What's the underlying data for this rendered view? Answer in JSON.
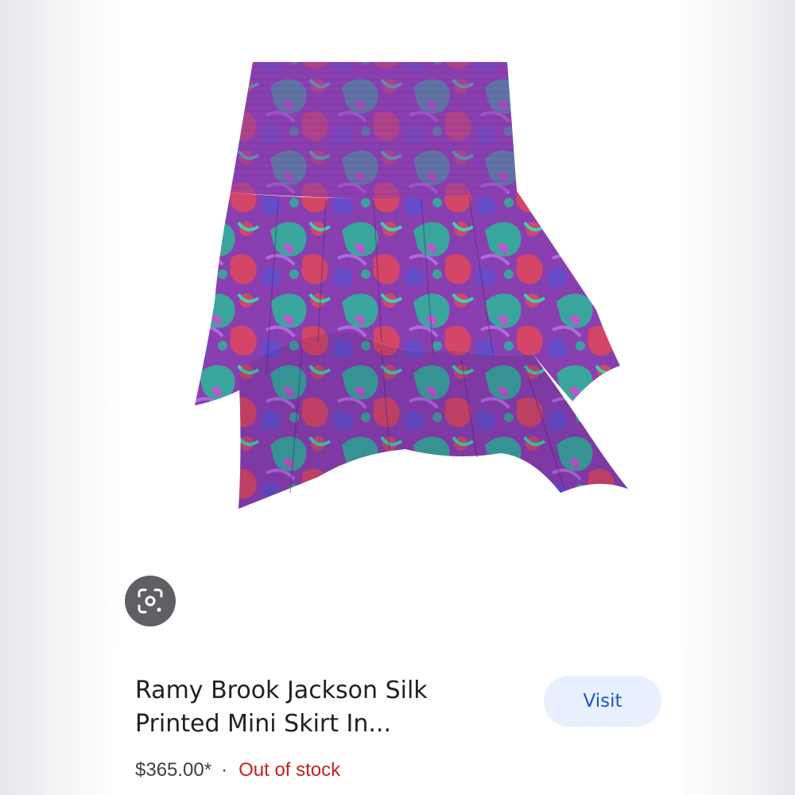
{
  "product": {
    "title": "Ramy Brook Jackson Silk Printed Mini Skirt In...",
    "price": "$365.00*",
    "separator": "·",
    "availability": "Out of stock",
    "availability_color": "#c5221f"
  },
  "actions": {
    "visit_label": "Visit",
    "lens_icon": "google-lens-icon"
  },
  "colors": {
    "visit_bg": "#e8f0fe",
    "visit_text": "#1a56c4",
    "lens_bg": "#5f6064"
  }
}
